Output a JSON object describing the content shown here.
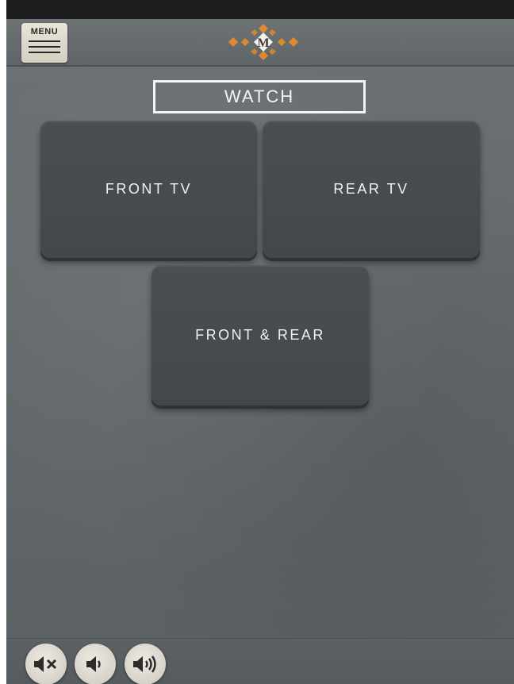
{
  "header": {
    "menu_label": "MENU",
    "logo_icon": "brand-emblem-icon",
    "logo_monogram": "M"
  },
  "page": {
    "title": "WATCH"
  },
  "tiles": [
    {
      "label": "FRONT TV"
    },
    {
      "label": "REAR TV"
    },
    {
      "label": "FRONT & REAR"
    }
  ],
  "footer": {
    "buttons": [
      {
        "icon": "mute-icon"
      },
      {
        "icon": "volume-down-icon"
      },
      {
        "icon": "volume-up-icon"
      }
    ]
  },
  "colors": {
    "background": "#62686b",
    "tile": "#474b4e",
    "button_face": "#e2ddd3",
    "logo_accent": "#e08a2c"
  }
}
